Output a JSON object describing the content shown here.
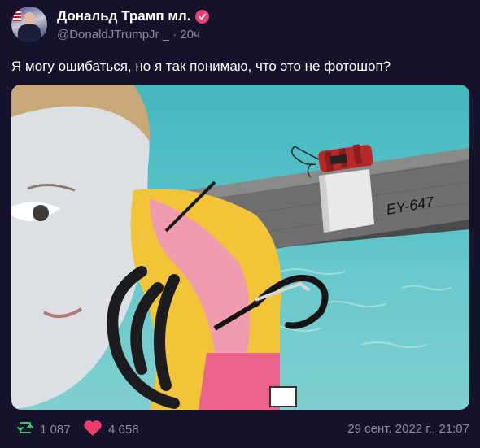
{
  "author": {
    "name": "Дональд Трамп мл.",
    "handle": "@DonaldJTrumpJr _",
    "separator": "·",
    "time_ago": "20ч"
  },
  "post": {
    "text": "Я могу ошибаться, но я так понимаю, что это не фотошоп?",
    "image_text": "EY-647"
  },
  "stats": {
    "reposts": "1 087",
    "likes": "4 658"
  },
  "date": "29 сент. 2022 г., 21:07",
  "colors": {
    "background": "#15132b",
    "muted_text": "#8d8aa5",
    "verified": "#ec3f6e",
    "repost": "#3fc26e",
    "like": "#ec3f6e"
  },
  "icons": {
    "verified": "verified-badge-icon",
    "repost": "repost-icon",
    "like": "heart-icon"
  }
}
